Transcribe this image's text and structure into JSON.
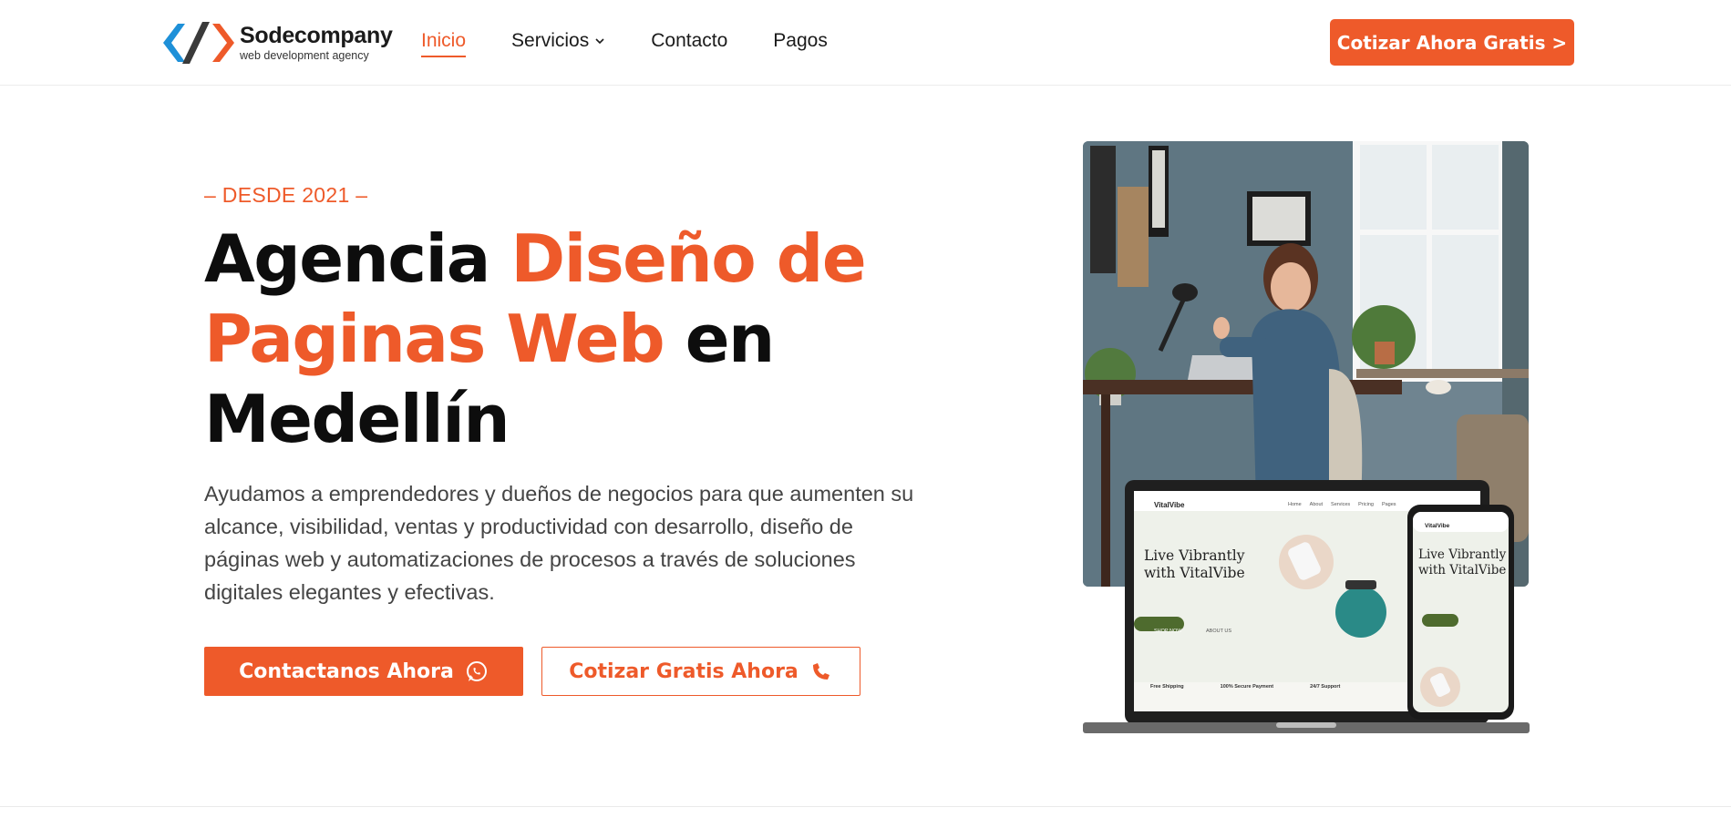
{
  "brand": {
    "name": "Sodecompany",
    "tagline": "web development agency"
  },
  "nav": {
    "items": [
      {
        "label": "Inicio",
        "active": true
      },
      {
        "label": "Servicios",
        "has_dropdown": true
      },
      {
        "label": "Contacto"
      },
      {
        "label": "Pagos"
      }
    ]
  },
  "header_cta": "Cotizar Ahora Gratis >",
  "hero": {
    "eyebrow": "– DESDE 2021 –",
    "title_part1": "Agencia ",
    "title_accent1": "Diseño de Paginas Web",
    "title_part2": " en Medellín",
    "description": "Ayudamos a emprendedores y dueños de negocios para que aumenten su alcance, visibilidad, ventas y productividad con desarrollo, diseño de páginas web y automatizaciones de procesos a través de soluciones digitales elegantes y efectivas.",
    "primary_button": "Contactanos Ahora",
    "secondary_button": "Cotizar Gratis Ahora"
  },
  "mockup": {
    "site_brand": "VitalVibe",
    "headline_line1": "Live Vibrantly",
    "headline_line2": "with VitalVibe",
    "nav_items": [
      "Home",
      "About",
      "Services",
      "Pricing",
      "Pages"
    ],
    "shop_button": "SHOP NOW",
    "about_link": "ABOUT US",
    "features": [
      "Free Shipping",
      "100% Secure Payment",
      "24/7 Support"
    ]
  },
  "colors": {
    "accent": "#ee5a2a",
    "text": "#0d0d0d",
    "body_text": "#444444"
  },
  "icons": {
    "primary_button_icon": "whatsapp-icon",
    "secondary_button_icon": "phone-icon",
    "dropdown_icon": "chevron-down-icon"
  }
}
